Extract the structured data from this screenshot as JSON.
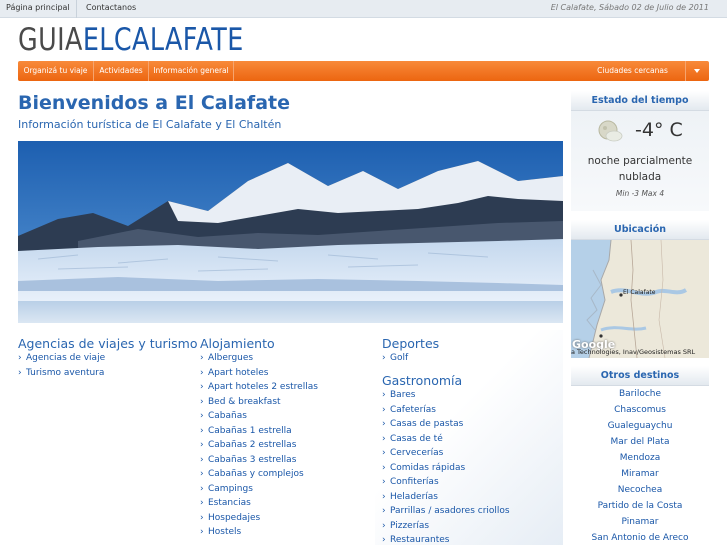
{
  "topbar": {
    "home": "Página principal",
    "contact": "Contactanos",
    "date": "El Calafate, Sábado 02 de Julio de 2011"
  },
  "logo": {
    "part1": "GUIA",
    "part2": "ELCALAFATE"
  },
  "nav": {
    "items": [
      "Organizá tu viaje",
      "Actividades",
      "Información general"
    ],
    "cities_label": "Ciudades cercanas"
  },
  "main": {
    "title": "Bienvenidos a El Calafate",
    "subtitle": "Información turística de El Calafate y El Chaltén"
  },
  "columns": {
    "agencias": {
      "title": "Agencias de viajes y turismo",
      "items": [
        "Agencias de viaje",
        "Turismo aventura"
      ]
    },
    "alojamiento": {
      "title": "Alojamiento",
      "items": [
        "Albergues",
        "Apart hoteles",
        "Apart hoteles 2 estrellas",
        "Bed & breakfast",
        "Cabañas",
        "Cabañas 1 estrella",
        "Cabañas 2 estrellas",
        "Cabañas 3 estrellas",
        "Cabañas y complejos",
        "Campings",
        "Estancias",
        "Hospedajes",
        "Hostels"
      ]
    },
    "deportes": {
      "title": "Deportes",
      "items": [
        "Golf"
      ]
    },
    "gastronomia": {
      "title": "Gastronomía",
      "items": [
        "Bares",
        "Cafeterías",
        "Casas de pastas",
        "Casas de té",
        "Cervecerías",
        "Comidas rápidas",
        "Confiterías",
        "Heladerías",
        "Parrillas / asadores criollos",
        "Pizzerías",
        "Restaurantes"
      ]
    }
  },
  "sidebar": {
    "weather": {
      "title": "Estado del tiempo",
      "temp": "-4° C",
      "desc_line1": "noche parcialmente",
      "desc_line2": "nublada",
      "minmax": "Min -3 Max 4",
      "icon": "partly-cloudy-night-icon"
    },
    "location": {
      "title": "Ubicación",
      "city_label": "El Calafate",
      "google": "Google",
      "credit": "a Technologies, Inav/Geosistemas SRL"
    },
    "other": {
      "title": "Otros destinos",
      "items": [
        "Bariloche",
        "Chascomus",
        "Gualeguaychu",
        "Mar del Plata",
        "Mendoza",
        "Miramar",
        "Necochea",
        "Partido de la Costa",
        "Pinamar",
        "San Antonio de Areco"
      ]
    }
  },
  "colors": {
    "accent_orange": "#f07522",
    "link_blue": "#1a57a8",
    "title_blue": "#2a66b0"
  }
}
